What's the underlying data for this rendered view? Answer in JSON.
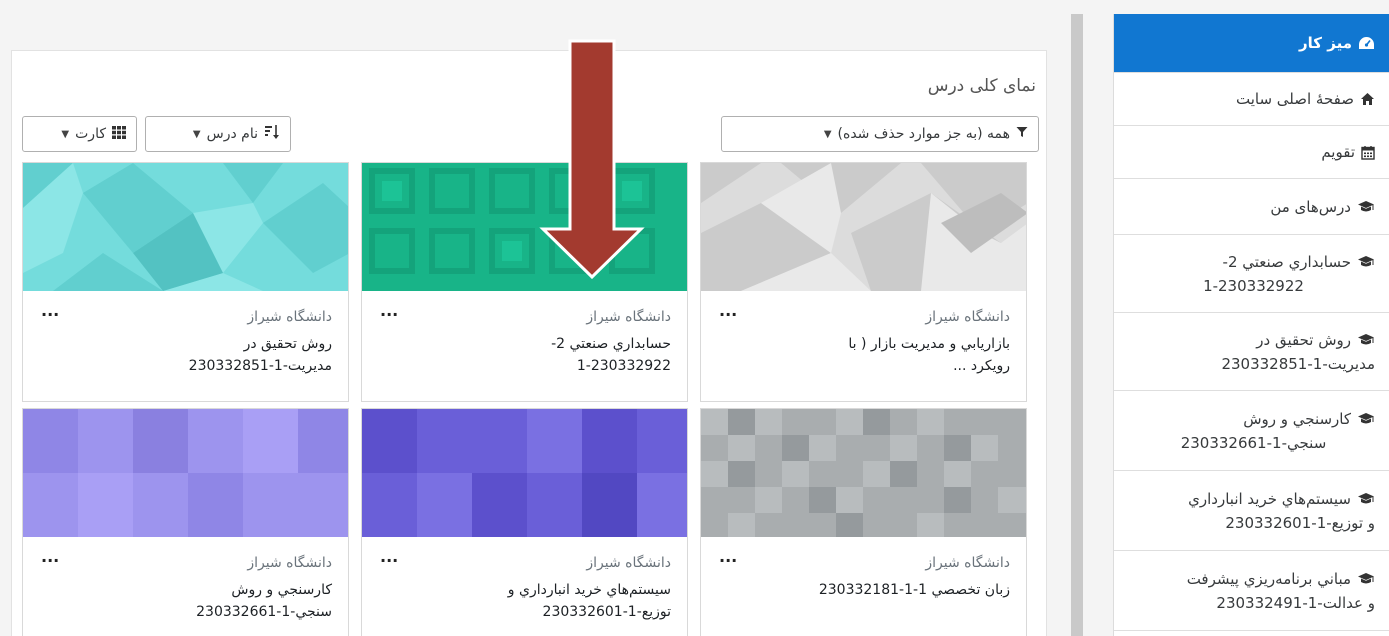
{
  "nav": {
    "items": [
      {
        "label": "میز کار",
        "icon": "dashboard-icon",
        "active": true
      },
      {
        "label": "صفحهٔ اصلی سایت",
        "icon": "home-icon"
      },
      {
        "label": "تقویم",
        "icon": "calendar-icon"
      },
      {
        "label": "درس‌های من",
        "icon": "graduation-cap-icon"
      },
      {
        "line1": "حسابداري صنعتي 2-",
        "line2": "1-230332922",
        "icon": "graduation-cap-icon"
      },
      {
        "line1": "روش تحقیق در",
        "line2": "مدیریت-1-230332851",
        "icon": "graduation-cap-icon"
      },
      {
        "line1": "کارسنجي و روش",
        "line2": "سنجي-1-230332661",
        "icon": "graduation-cap-icon"
      },
      {
        "line1": "سیستم‌هاي خريد انبارداري",
        "line2": "و توزيع-1-230332601",
        "icon": "graduation-cap-icon"
      },
      {
        "line1": "مباني برنامه‌ریزي پیشرفت",
        "line2": "و عدالت-1-230332491",
        "icon": "graduation-cap-icon"
      }
    ]
  },
  "block": {
    "title": "نمای کلی درس",
    "filter_label": "همه (به جز موارد حذف شده)",
    "sort_label": "نام درس",
    "view_label": "کارت"
  },
  "courses": [
    {
      "category": "دانشگاه شیراز",
      "name1": "بازاريابي و مديريت بازار ( با",
      "name2": "رويکرد ...",
      "menu": "...",
      "palette": "grey-diamonds"
    },
    {
      "category": "دانشگاه شیراز",
      "name1": "حسابداري صنعتي 2-",
      "name2": "1-230332922",
      "menu": "...",
      "palette": "green-squares"
    },
    {
      "category": "دانشگاه شیراز",
      "name1": "روش تحقیق در",
      "name2": "مدیریت-1-230332851",
      "menu": "...",
      "palette": "teal-diamonds"
    },
    {
      "category": "دانشگاه شیراز",
      "name1": "زبان تخصصي 1-1-230332181",
      "name2": "",
      "menu": "...",
      "palette": "grey-pixels"
    },
    {
      "category": "دانشگاه شیراز",
      "name1": "سیستم‌هاي خريد انبارداري و",
      "name2": "توزيع-1-230332601",
      "menu": "...",
      "palette": "indigo-blocks"
    },
    {
      "category": "دانشگاه شیراز",
      "name1": "کارسنجي و روش",
      "name2": "سنجي-1-230332661",
      "menu": "...",
      "palette": "lavender-blocks"
    }
  ],
  "colors": {
    "accent": "#1177d1",
    "arrow": "#a33a2f"
  }
}
